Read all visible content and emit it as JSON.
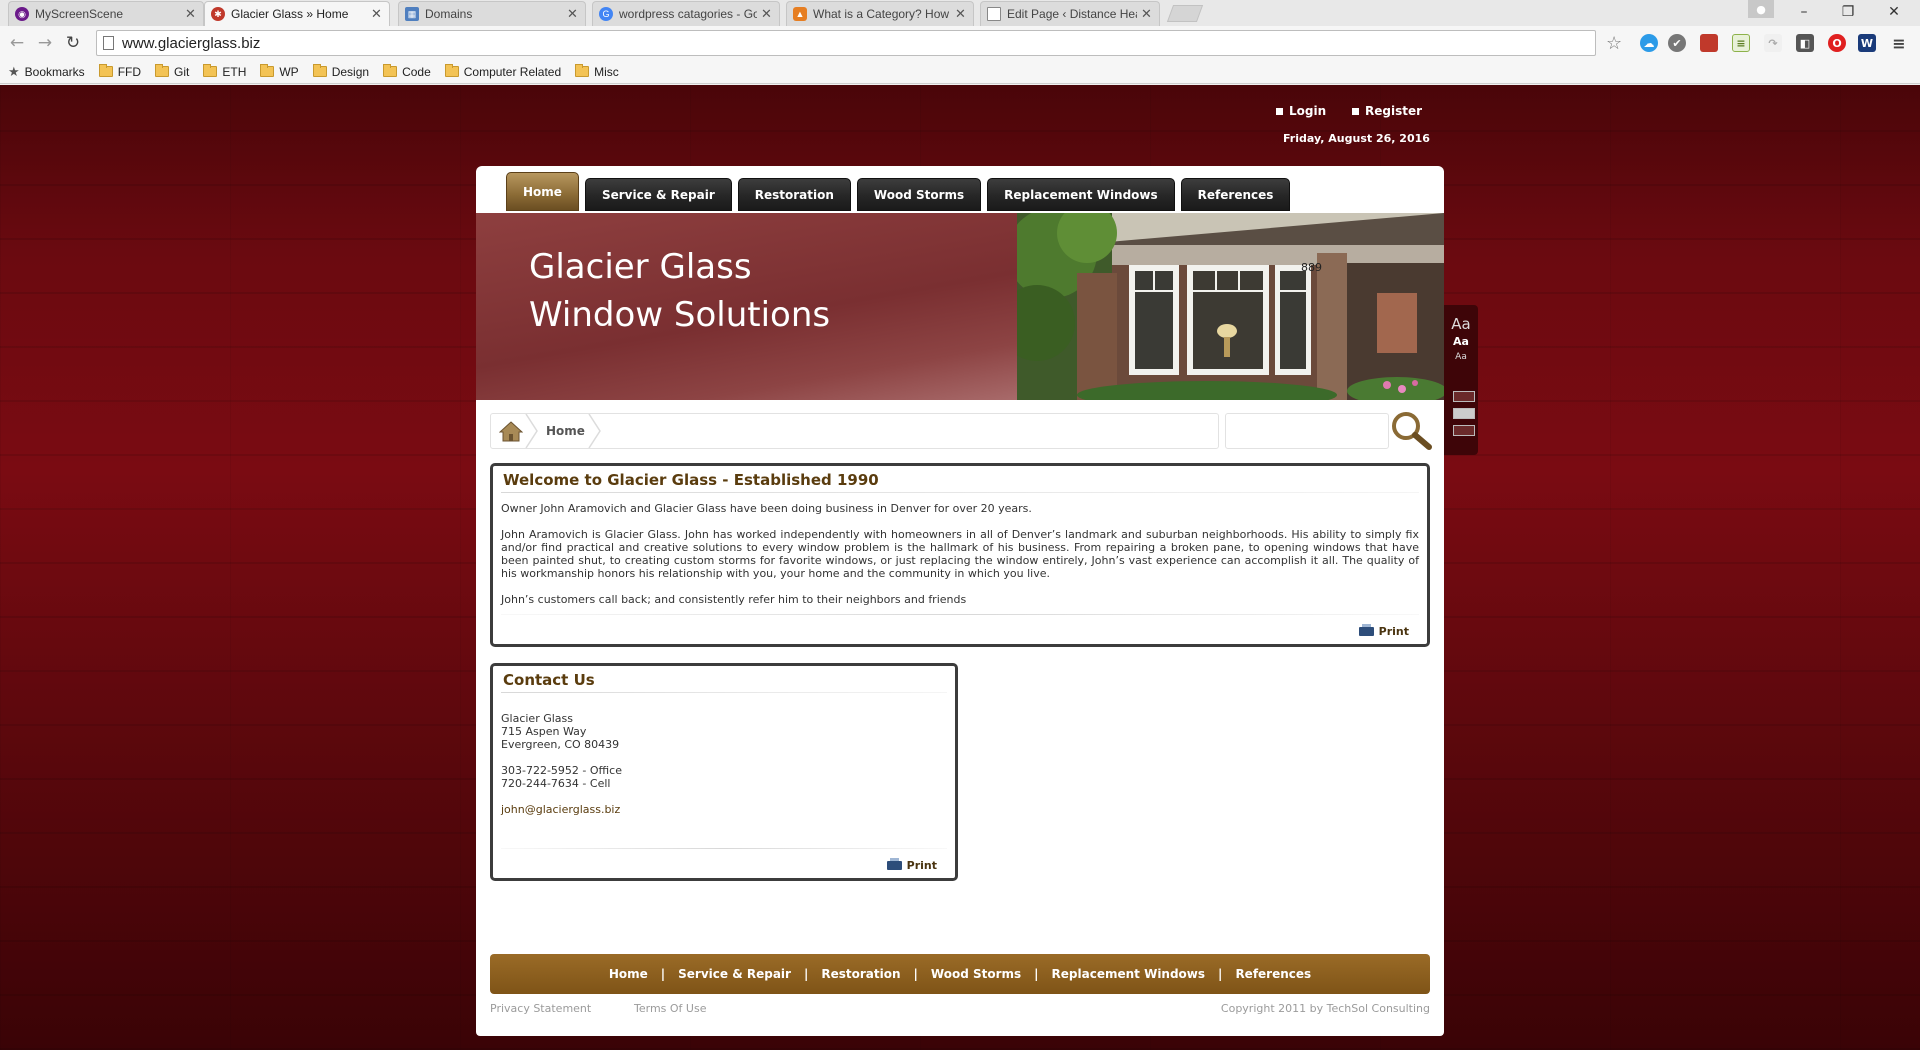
{
  "browser": {
    "tabs": [
      {
        "title": "MyScreenScene",
        "favicon_color": "#6b1a8a"
      },
      {
        "title": "Glacier Glass » Home",
        "favicon_color": "#c0392b"
      },
      {
        "title": "Domains",
        "favicon_color": "#4f7fbf"
      },
      {
        "title": "wordpress catagories - Go",
        "favicon_color": "#4285f4"
      },
      {
        "title": "What is a Category? How",
        "favicon_color": "#e67e22"
      },
      {
        "title": "Edit Page ‹ Distance Heali",
        "favicon_color": "#888888"
      }
    ],
    "url": "www.glacierglass.biz",
    "bookmarks": [
      {
        "label": "Bookmarks",
        "type": "star"
      },
      {
        "label": "FFD",
        "type": "folder"
      },
      {
        "label": "Git",
        "type": "folder"
      },
      {
        "label": "ETH",
        "type": "folder"
      },
      {
        "label": "WP",
        "type": "folder"
      },
      {
        "label": "Design",
        "type": "folder"
      },
      {
        "label": "Code",
        "type": "folder"
      },
      {
        "label": "Computer Related",
        "type": "folder"
      },
      {
        "label": "Misc",
        "type": "folder"
      }
    ],
    "window_controls": {
      "minimize": "–",
      "restore": "❐",
      "close": "✕"
    },
    "extension_icons": [
      "cloud-icon",
      "pocket-icon",
      "red-bookmark-icon",
      "doc-icon",
      "share-icon",
      "dropbox-icon",
      "opera-icon",
      "w-icon",
      "menu-icon"
    ]
  },
  "site": {
    "top_links": {
      "login": "Login",
      "register": "Register"
    },
    "date": "Friday, August 26, 2016",
    "nav": [
      "Home",
      "Service & Repair",
      "Restoration",
      "Wood Storms",
      "Replacement Windows",
      "References"
    ],
    "nav_active_index": 0,
    "banner": {
      "line1": "Glacier Glass",
      "line2": "Window Solutions",
      "house_number": "889"
    },
    "font_sizer": {
      "large": "Aa",
      "medium": "Aa",
      "small": "Aa"
    },
    "breadcrumb": {
      "current": "Home"
    },
    "welcome": {
      "title": "Welcome to Glacier Glass - Established 1990",
      "paragraphs": [
        "Owner John Aramovich and Glacier Glass have been doing business in Denver for over 20 years.",
        "John Aramovich is Glacier Glass.  John has worked independently with homeowners in all of Denver’s landmark and suburban neighborhoods.  His ability to simply fix and/or find practical and creative solutions to every window problem is the hallmark of his business.  From repairing a broken pane, to opening windows that have been painted shut, to creating custom storms for favorite windows, or just replacing the window entirely, John’s vast experience can accomplish it all.  The quality of his workmanship honors his relationship with you, your home and the community in which you live.",
        "John’s customers call back; and consistently refer him to their neighbors and friends"
      ],
      "print_label": "Print"
    },
    "contact": {
      "title": "Contact Us",
      "name": "Glacier Glass",
      "street": "715 Aspen Way",
      "city": "Evergreen, CO 80439",
      "office": "303-722-5952 - Office",
      "cell": "720-244-7634 - Cell",
      "email": "john@glacierglass.biz",
      "print_label": "Print"
    },
    "footer": {
      "links": [
        "Home",
        "Service & Repair",
        "Restoration",
        "Wood Storms",
        "Replacement Windows",
        "References"
      ],
      "separator": "|",
      "privacy": "Privacy Statement",
      "terms": "Terms Of Use",
      "copyright": "Copyright 2011 by TechSol Consulting"
    }
  }
}
